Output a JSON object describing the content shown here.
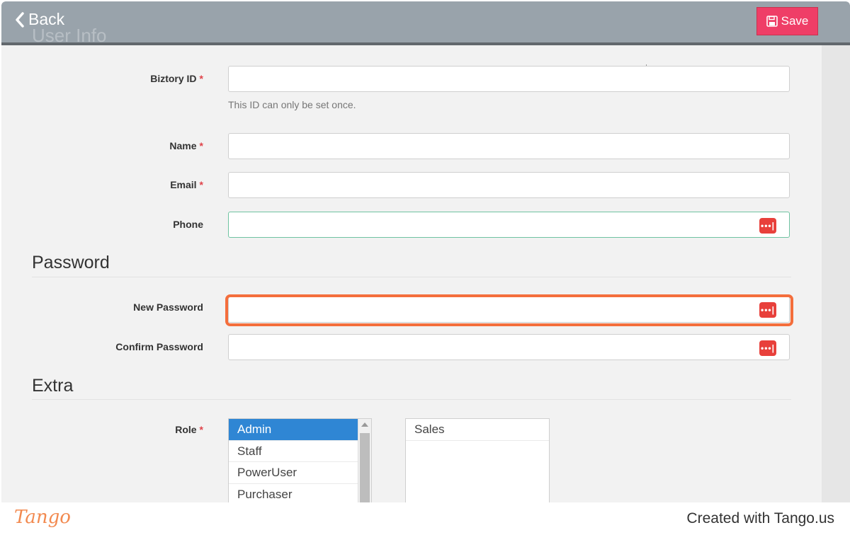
{
  "header": {
    "back_label": "Back",
    "ghost_title": "User Info",
    "save_label": "Save"
  },
  "form": {
    "biztory_id": {
      "label": "Biztory ID",
      "required": "*",
      "value": "",
      "help": "This ID can only be set once."
    },
    "name": {
      "label": "Name",
      "required": "*",
      "value": ""
    },
    "email": {
      "label": "Email",
      "required": "*",
      "value": ""
    },
    "phone": {
      "label": "Phone",
      "value": ""
    }
  },
  "password_section": {
    "title": "Password",
    "new_password": {
      "label": "New Password",
      "value": ""
    },
    "confirm_password": {
      "label": "Confirm Password",
      "value": ""
    }
  },
  "extra_section": {
    "title": "Extra",
    "role": {
      "label": "Role",
      "required": "*",
      "available": [
        "Admin",
        "Staff",
        "PowerUser",
        "Purchaser"
      ],
      "selected_option": "Admin",
      "assigned": [
        "Sales"
      ]
    }
  },
  "footer": {
    "logo": "Tango",
    "credit": "Created with Tango.us"
  },
  "colors": {
    "accent_save": "#ef3e67",
    "highlight": "#f46e3c",
    "selected_option": "#2f86d4",
    "password_manager_icon": "#e8403b"
  }
}
